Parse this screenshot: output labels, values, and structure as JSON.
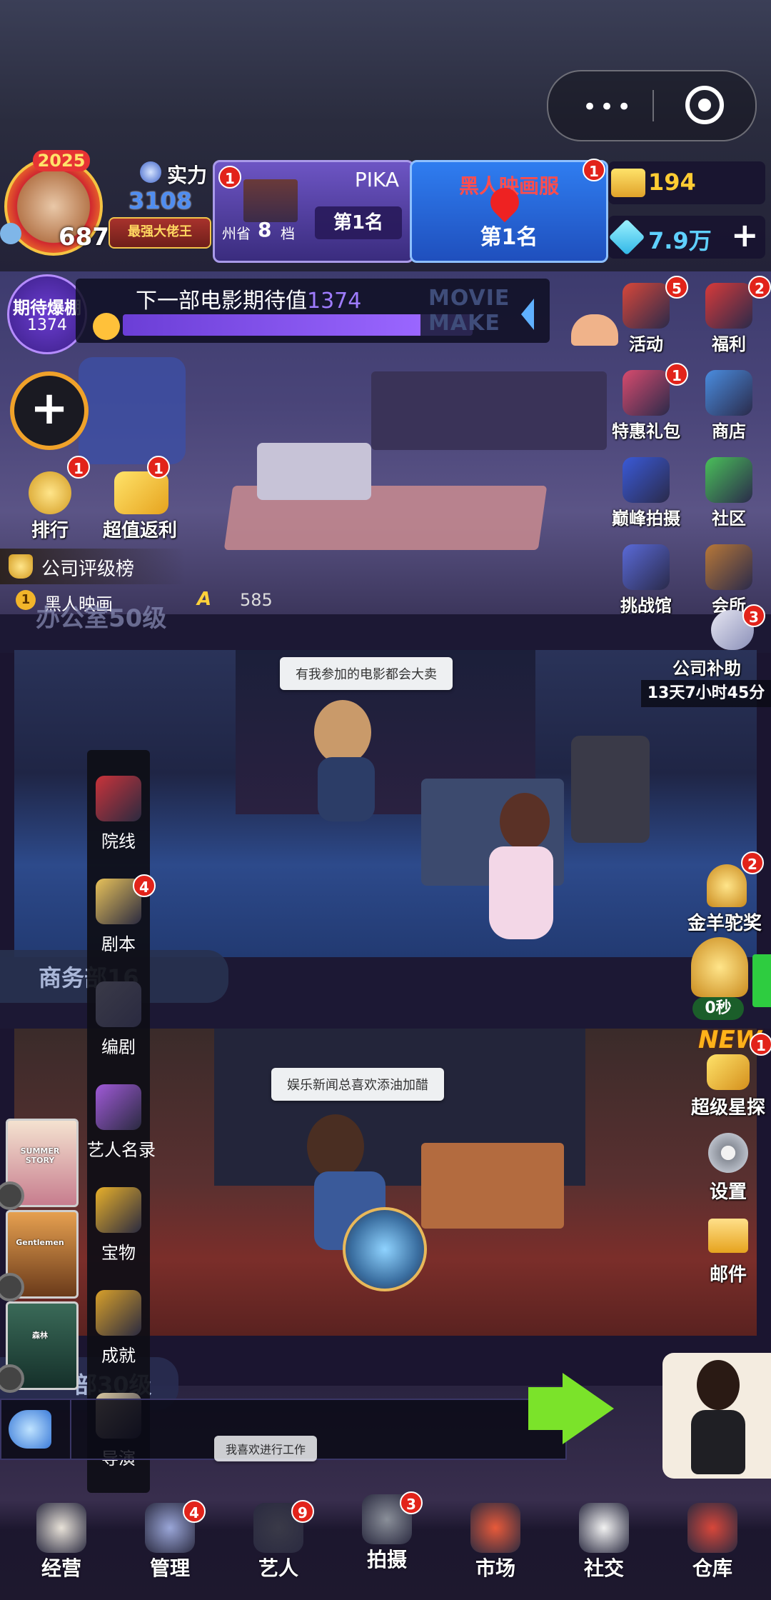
{
  "player": {
    "year_badge": "2025",
    "level": "687",
    "power_label": "实力",
    "power_value": "3108万",
    "title_badge": "最强大佬王",
    "rank_badge": "1"
  },
  "rank_card_pika": {
    "name": "PIKA",
    "region": "州省",
    "tier_number": "8",
    "tier_unit": "档",
    "rank": "第1名",
    "badge": "1"
  },
  "rank_card_server": {
    "name": "黑人映画服",
    "rank": "第1名",
    "badge": "1"
  },
  "currency": {
    "gold": "194",
    "diamond": "7.9万",
    "plus_label": "+"
  },
  "expectation": {
    "badge_title": "期待爆棚",
    "badge_value": "1374",
    "label": "下一部电影期待值",
    "value": "1374",
    "sign": "MOVIE MAKE",
    "progress": 0.85
  },
  "left_actions": [
    {
      "label": "排行",
      "badge": "1",
      "icon": "trophy-icon"
    },
    {
      "label": "超值返利",
      "badge": "1",
      "icon": "ticket-icon"
    }
  ],
  "add_button": "+",
  "company_rating": {
    "title": "公司评级榜",
    "rank_no": "1",
    "company": "黑人映画",
    "grade": "A",
    "score": "585"
  },
  "floor_labels": {
    "office": "办公室50级",
    "business": "商务部16",
    "dept3": "部30级"
  },
  "right_menu": [
    {
      "label": "活动",
      "badge": "5",
      "icon": "gift-box-icon"
    },
    {
      "label": "福利",
      "badge": "2",
      "icon": "present-icon"
    },
    {
      "label": "特惠礼包",
      "badge": "1",
      "icon": "gift-bag-icon"
    },
    {
      "label": "商店",
      "badge": "",
      "icon": "shop-icon"
    },
    {
      "label": "巅峰拍摄",
      "badge": "",
      "icon": "star-trophy-icon"
    },
    {
      "label": "社区",
      "badge": "",
      "icon": "chat-icon"
    },
    {
      "label": "挑战馆",
      "badge": "",
      "icon": "building-icon"
    },
    {
      "label": "会所",
      "badge": "",
      "icon": "club-icon"
    }
  ],
  "company_subsidy": {
    "label": "公司补助",
    "badge": "3",
    "timer": "13天7小时45分"
  },
  "golden_award": {
    "label": "金羊驼奖",
    "badge": "2"
  },
  "trophy_timer": "0秒",
  "new_tag": "NEW",
  "super_scout": {
    "label": "超级星探",
    "badge": "1"
  },
  "settings": {
    "label": "设置"
  },
  "mail": {
    "label": "邮件"
  },
  "bubbles": {
    "room2": "有我参加的电影都会大卖",
    "room3": "娱乐新闻总喜欢添油加醋",
    "bottom": "我喜欢进行工作"
  },
  "left_menu": [
    {
      "label": "院线",
      "badge": "",
      "icon": "cinema-icon"
    },
    {
      "label": "剧本",
      "badge": "4",
      "icon": "script-icon"
    },
    {
      "label": "编剧",
      "badge": "",
      "icon": "writer-icon"
    },
    {
      "label": "艺人名录",
      "badge": "",
      "icon": "roster-icon"
    },
    {
      "label": "宝物",
      "badge": "",
      "icon": "lamp-icon"
    },
    {
      "label": "成就",
      "badge": "",
      "icon": "medal-icon"
    },
    {
      "label": "导演",
      "badge": "",
      "icon": "vest-icon"
    }
  ],
  "posters": [
    {
      "caption": "SUMMER STORY"
    },
    {
      "caption": "Gentlemen"
    },
    {
      "caption": "森林"
    }
  ],
  "bottom_nav": [
    {
      "label": "经营",
      "badge": "",
      "icon": "popcorn-icon"
    },
    {
      "label": "管理",
      "badge": "4",
      "icon": "manage-icon"
    },
    {
      "label": "艺人",
      "badge": "9",
      "icon": "actor-icon"
    },
    {
      "label": "拍摄",
      "badge": "3",
      "icon": "camera-icon"
    },
    {
      "label": "市场",
      "badge": "",
      "icon": "chart-icon"
    },
    {
      "label": "社交",
      "badge": "",
      "icon": "coffee-icon"
    },
    {
      "label": "仓库",
      "badge": "",
      "icon": "warehouse-icon"
    }
  ]
}
